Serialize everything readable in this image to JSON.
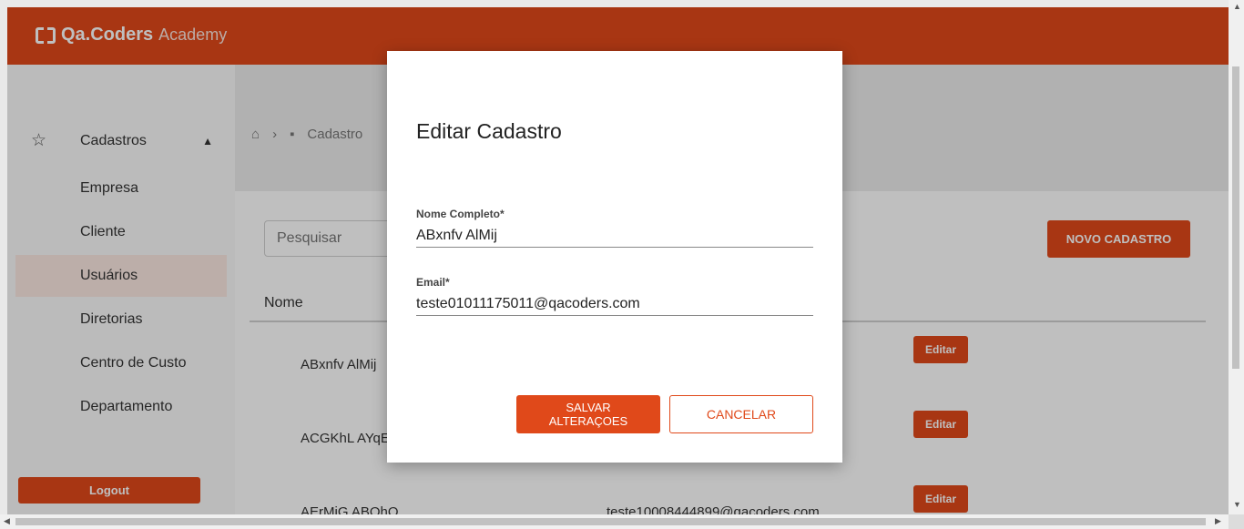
{
  "app": {
    "logo_text": "Qa.Coders",
    "logo_academy": "Academy"
  },
  "sidebar": {
    "section_label": "Cadastros",
    "items": [
      {
        "label": "Empresa"
      },
      {
        "label": "Cliente"
      },
      {
        "label": "Usuários"
      },
      {
        "label": "Diretorias"
      },
      {
        "label": "Centro de Custo"
      },
      {
        "label": "Departamento"
      }
    ],
    "logout_label": "Logout"
  },
  "breadcrumb": {
    "current": "Cadastro"
  },
  "main": {
    "search_placeholder": "Pesquisar",
    "new_button": "NOVO CADASTRO",
    "column_name": "Nome",
    "rows": [
      {
        "name": "ABxnfv AlMij",
        "email": "",
        "action": "Editar"
      },
      {
        "name": "ACGKhL AYqE",
        "email": "",
        "action": "Editar"
      },
      {
        "name": "AErMiG ABOhQ",
        "email": "teste10008444899@qacoders.com",
        "action": "Editar"
      }
    ]
  },
  "modal": {
    "title": "Editar Cadastro",
    "name_label": "Nome Completo*",
    "name_value": "ABxnfv AlMij",
    "email_label": "Email*",
    "email_value": "teste01011175011@qacoders.com",
    "save_label": "SALVAR ALTERAÇOES",
    "cancel_label": "CANCELAR"
  },
  "colors": {
    "brand": "#e0491a"
  }
}
